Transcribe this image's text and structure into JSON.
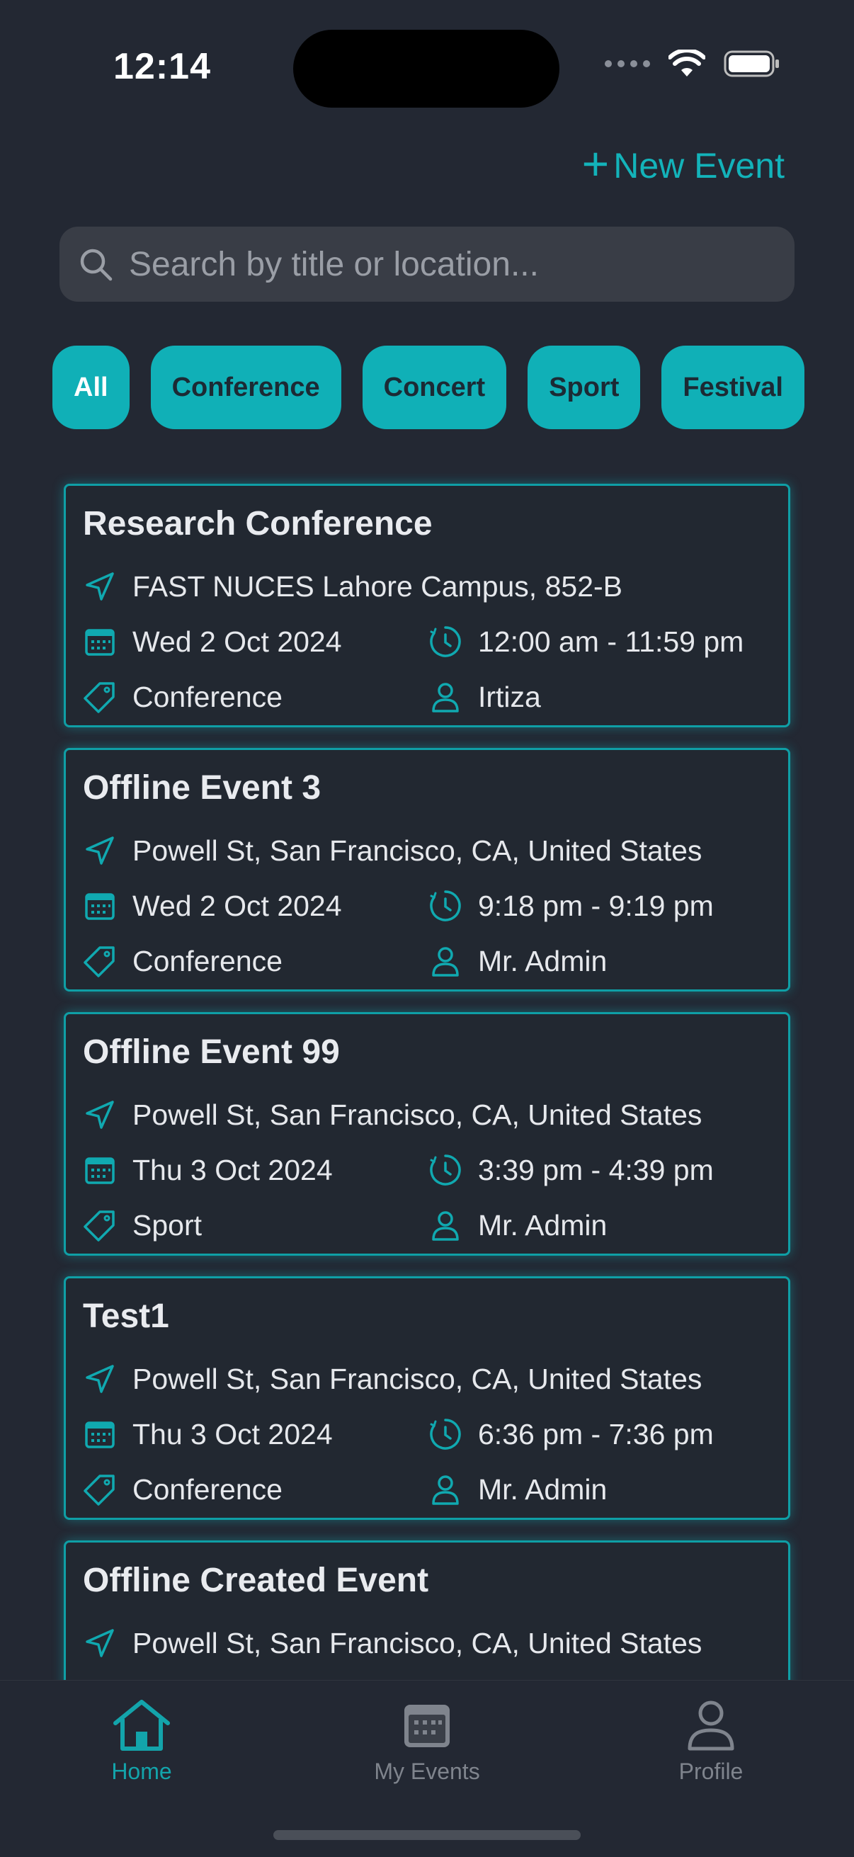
{
  "status_bar": {
    "time": "12:14"
  },
  "header": {
    "new_event_label": "New Event",
    "new_event_icon": "plus-icon"
  },
  "search": {
    "placeholder": "Search by title or location..."
  },
  "filters": [
    {
      "label": "All",
      "active": true
    },
    {
      "label": "Conference",
      "active": false
    },
    {
      "label": "Concert",
      "active": false
    },
    {
      "label": "Sport",
      "active": false
    },
    {
      "label": "Festival",
      "active": false
    }
  ],
  "events": [
    {
      "title": "Research Conference",
      "location": "FAST NUCES Lahore Campus, 852-B",
      "date": "Wed 2 Oct 2024",
      "time": "12:00 am - 11:59 pm",
      "category": "Conference",
      "organizer": "Irtiza"
    },
    {
      "title": "Offline Event 3",
      "location": "Powell St, San Francisco, CA, United States",
      "date": "Wed 2 Oct 2024",
      "time": "9:18 pm - 9:19 pm",
      "category": "Conference",
      "organizer": "Mr. Admin"
    },
    {
      "title": "Offline Event 99",
      "location": "Powell St, San Francisco, CA, United States",
      "date": "Thu 3 Oct 2024",
      "time": "3:39 pm - 4:39 pm",
      "category": "Sport",
      "organizer": "Mr. Admin"
    },
    {
      "title": "Test1",
      "location": "Powell St, San Francisco, CA, United States",
      "date": "Thu 3 Oct 2024",
      "time": "6:36 pm - 7:36 pm",
      "category": "Conference",
      "organizer": "Mr. Admin"
    },
    {
      "title": "Offline Created Event",
      "location": "Powell St, San Francisco, CA, United States"
    }
  ],
  "bottom_nav": [
    {
      "label": "Home",
      "icon": "home-icon",
      "active": true
    },
    {
      "label": "My Events",
      "icon": "calendar-icon",
      "active": false
    },
    {
      "label": "Profile",
      "icon": "person-icon",
      "active": false
    }
  ],
  "colors": {
    "accent": "#10b0b7",
    "background": "#232833",
    "card_border": "#0f9fa6",
    "search_bg": "#393d46"
  }
}
